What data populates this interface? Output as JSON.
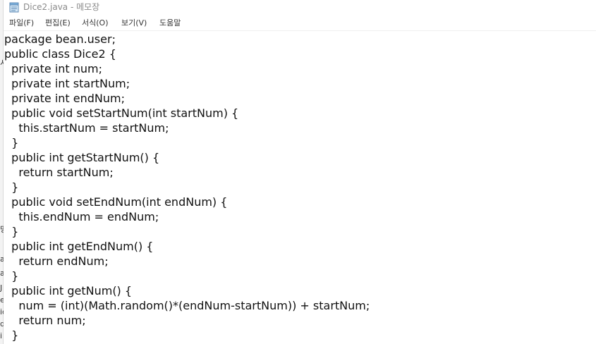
{
  "window": {
    "title": "Dice2.java - 메모장",
    "icon": "notepad-icon"
  },
  "menu": {
    "items": [
      {
        "label": "파일(F)"
      },
      {
        "label": "편집(E)"
      },
      {
        "label": "서식(O)"
      },
      {
        "label": "보기(V)"
      },
      {
        "label": "도움말"
      }
    ]
  },
  "editor": {
    "lines": [
      "package bean.user;",
      "public class Dice2 {",
      "  private int num;",
      "  private int startNum;",
      "  private int endNum;",
      "  public void setStartNum(int startNum) {",
      "    this.startNum = startNum;",
      "  }",
      "  public int getStartNum() {",
      "    return startNum;",
      "  }",
      "  public void setEndNum(int endNum) {",
      "    this.endNum = endNum;",
      "  }",
      "  public int getEndNum() {",
      "    return endNum;",
      "  }",
      "  public int getNum() {",
      "    num = (int)(Math.random()*(endNum-startNum)) + startNum;",
      "    return num;",
      "  }"
    ]
  },
  "background_window": {
    "edge_glyphs": [
      "시",
      "명",
      "a",
      "a",
      "J",
      "e",
      "ic",
      "d",
      "i"
    ]
  },
  "colors": {
    "title_text": "#8a8a8a",
    "menu_text": "#333333",
    "code_text": "#111111",
    "background": "#ffffff"
  }
}
